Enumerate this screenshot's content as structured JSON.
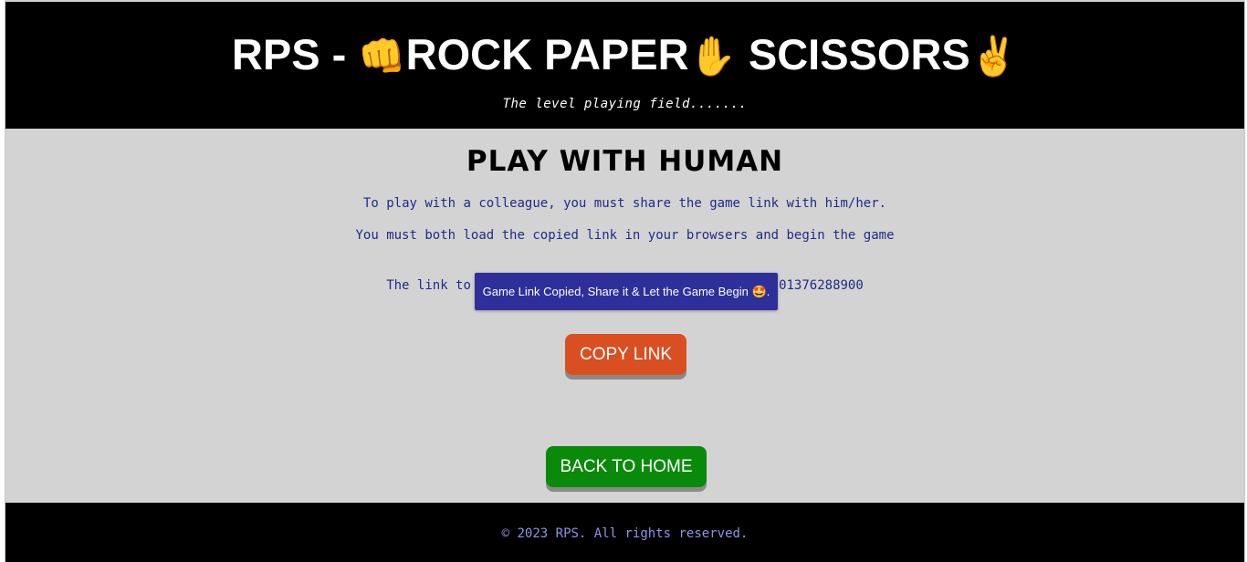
{
  "header": {
    "title_prefix": "RPS - ",
    "rock_emoji": "👊",
    "rock_paper_text": "ROCK PAPER",
    "paper_emoji": "✋",
    "scissors_text": " SCISSORS",
    "scissors_emoji": "✌",
    "tagline": "The level playing field......."
  },
  "main": {
    "heading": "PLAY WITH HUMAN",
    "instruction_1": "To play with a colleague, you must share the game link with him/her.",
    "instruction_2": "You must both load the copied link in your browsers and begin the game",
    "share_prefix": "The link to share is: ",
    "share_link": "https://...vercel.app/game_1701376288900",
    "toast": "Game Link Copied, Share it & Let the Game Begin 🤩.",
    "copy_button_label": "COPY LINK",
    "home_button_label": "BACK TO HOME"
  },
  "footer": {
    "copyright": "© 2023 RPS. All rights reserved."
  },
  "colors": {
    "header_bg": "#000000",
    "main_bg": "#d3d3d3",
    "instruction_text": "#1f2a8a",
    "toast_bg": "#2e2f9a",
    "copy_button_bg": "#d94f22",
    "home_button_bg": "#0a8a0a",
    "footer_text": "#8f93e8"
  }
}
